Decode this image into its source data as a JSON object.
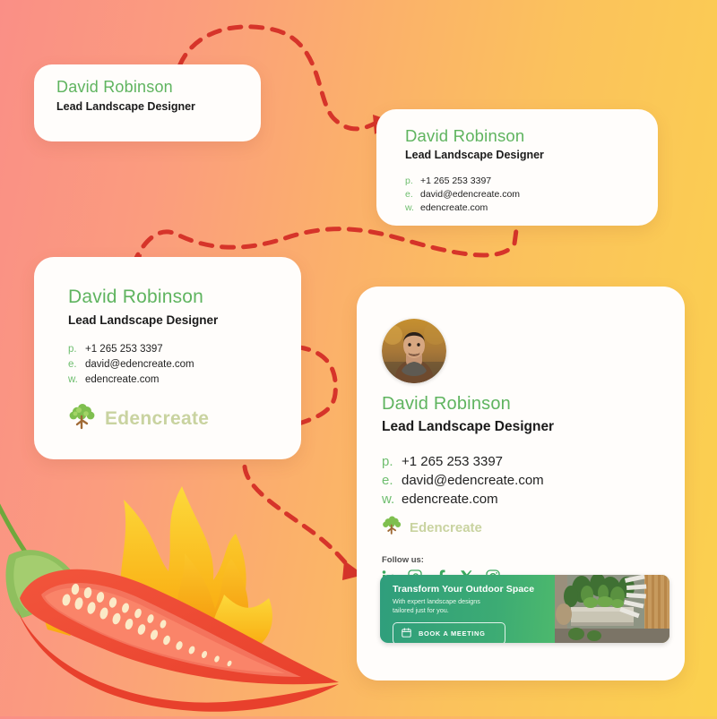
{
  "background": {
    "left_color": "#FA8F86",
    "right_color": "#FBD14E"
  },
  "accent": {
    "green": "#5FB45F",
    "tab_green": "#6FBE6F",
    "brand_sage": "#C9D3A0",
    "arrow_red": "#D6342A"
  },
  "person": {
    "name": "David Robinson",
    "role": "Lead Landscape Designer",
    "phone_label": "p.",
    "phone": "+1 265 253 3397",
    "email_label": "e.",
    "email": "david@edencreate.com",
    "web_label": "w.",
    "web": "edencreate.com"
  },
  "brand": {
    "name": "Edencreate",
    "logo_icon": "tree-icon"
  },
  "cards": [
    {
      "id": "card-minimal",
      "shows": [
        "name",
        "role"
      ]
    },
    {
      "id": "card-contact",
      "shows": [
        "name",
        "role",
        "contacts"
      ]
    },
    {
      "id": "card-branded",
      "shows": [
        "name",
        "role",
        "contacts",
        "logo"
      ]
    },
    {
      "id": "card-full",
      "shows": [
        "avatar",
        "name",
        "role",
        "contacts",
        "logo",
        "socials",
        "promo"
      ]
    }
  ],
  "follow": {
    "label": "Follow us:",
    "socials": [
      {
        "name": "linkedin-icon",
        "glyph": "in"
      },
      {
        "name": "pinterest-icon",
        "glyph": "P"
      },
      {
        "name": "facebook-icon",
        "glyph": "f"
      },
      {
        "name": "x-icon",
        "glyph": "X"
      },
      {
        "name": "instagram-icon",
        "glyph": "O"
      }
    ]
  },
  "promo": {
    "title": "Transform Your Outdoor Space",
    "subtitle_line1": "With expert landscape designs",
    "subtitle_line2": "tailored just for you.",
    "button_label": "BOOK A MEETING",
    "button_icon": "calendar-icon",
    "image_alt": "garden-patio-photo",
    "gradient_from": "#2F9E7C",
    "gradient_to": "#6CCB63"
  },
  "decor": {
    "illustration": "chili-pepper-with-flames",
    "connector_count": 3,
    "connector_style": "dashed-red-arrow"
  }
}
